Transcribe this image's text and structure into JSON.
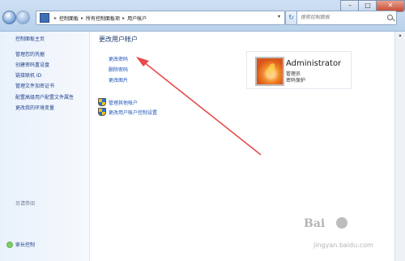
{
  "window": {
    "address": {
      "crumbs": [
        "控制面板",
        "所有控制面板项",
        "用户帐户"
      ],
      "separator": "▸"
    },
    "search": {
      "placeholder": "搜索控制面板"
    },
    "controls": {
      "min": "–",
      "max": "□",
      "close": "✕"
    }
  },
  "sidebar": {
    "items": [
      {
        "label": "控制面板主页"
      },
      {
        "label": "管理您的凭据"
      },
      {
        "label": "创建密码重设盘"
      },
      {
        "label": "链接联机 ID"
      },
      {
        "label": "管理文件加密证书"
      },
      {
        "label": "配置高级用户配置文件属性"
      },
      {
        "label": "更改我的环境变量"
      }
    ],
    "see_also": "另请参阅",
    "parental_controls": "家长控制"
  },
  "main": {
    "title": "更改用户帐户",
    "tasks": [
      "更改密码",
      "删除密码",
      "更改图片"
    ],
    "shield_tasks": [
      "管理其他帐户",
      "更改用户帐户控制设置"
    ]
  },
  "account": {
    "name": "Administrator",
    "role": "管理员",
    "status": "密码保护"
  },
  "watermark": {
    "brand": "Bai",
    "url": "jingyan.baidu.com"
  },
  "colors": {
    "annotation_arrow": "#e84a4a",
    "link": "#1e54b8"
  }
}
